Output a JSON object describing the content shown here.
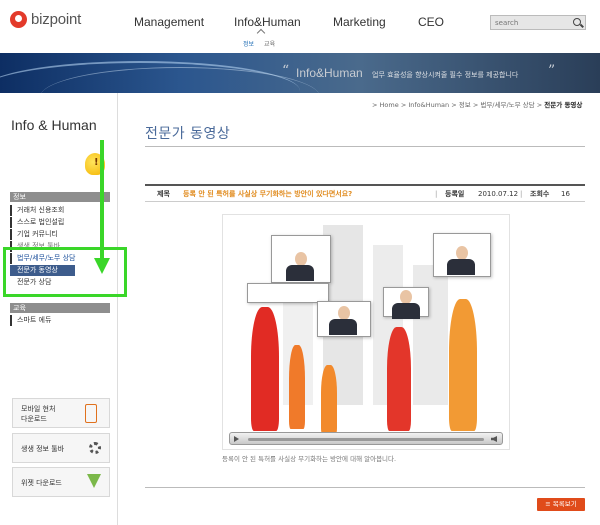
{
  "brand": {
    "name": "bizpoint",
    "accent": "#e33a2a"
  },
  "nav": {
    "items": [
      "Management",
      "Info&Human",
      "Marketing",
      "CEO"
    ],
    "subnav": [
      "정보",
      "교육"
    ],
    "search_placeholder": "search"
  },
  "banner": {
    "open_quote": "“",
    "close_quote": "”",
    "title": "Info&Human",
    "text": "업무 효율성을 향상시켜줄 필수 정보를 제공합니다"
  },
  "sidebar": {
    "title": "Info & Human",
    "section_info": "정보",
    "info_items": [
      "거래처 신용조회",
      "스스로 법인설립",
      "기업 커뮤니티",
      "생생 정보 툴바"
    ],
    "law_item": "법무/세무/노무 상담",
    "active_item": "전문가 동영상",
    "expert_item": "전문가 상담",
    "section_edu": "교육",
    "edu_items": [
      "스마트 에듀"
    ],
    "promos": [
      {
        "label": "모바일 현처\n다운로드",
        "icon": "mobile-icon"
      },
      {
        "label": "생생 정보 툴바",
        "icon": "gear-icon"
      },
      {
        "label": "위젯 다운로드",
        "icon": "download-arrow-icon"
      }
    ]
  },
  "breadcrumb": {
    "items": [
      "Home",
      "Info&Human",
      "정보",
      "법무/세무/노무 상담"
    ],
    "separator": ">",
    "current": "전문가 동영상"
  },
  "page": {
    "title": "전문가 동영상",
    "subject_label": "제목",
    "subject": "등록 안 된 특허를 사실상 무기화하는 방안이 있다면서요?",
    "date_label": "등록일",
    "date": "2010.07.12",
    "views_label": "조회수",
    "views": "16",
    "caption": "등록이 안 된 특허를 사실상 무기화하는 방안에 대해 알아봅니다.",
    "list_button": "목록보기",
    "list_icon": "≡"
  }
}
